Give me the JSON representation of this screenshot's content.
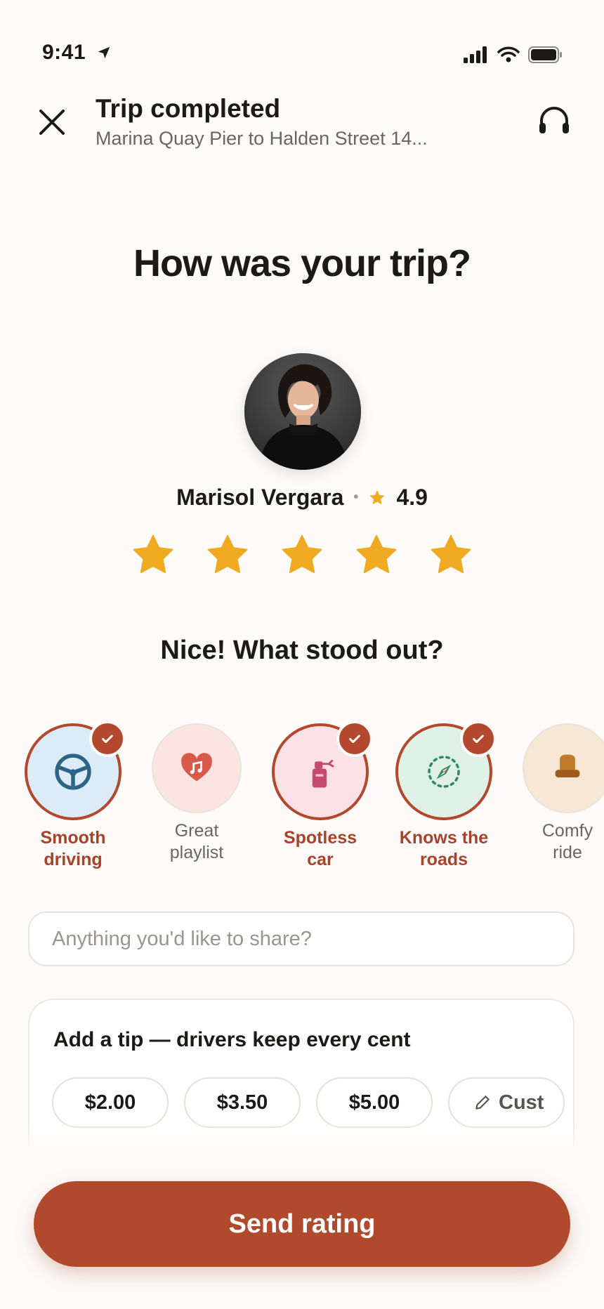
{
  "status_bar": {
    "time": "9:41"
  },
  "header": {
    "title": "Trip completed",
    "subtitle": "Marina Quay Pier to Halden Street 14..."
  },
  "question": "How was your trip?",
  "driver": {
    "name": "Marisol Vergara",
    "rating": "4.9"
  },
  "user_rating": {
    "stars_selected": 5,
    "stars_total": 5
  },
  "prompt": "Nice! What stood out?",
  "tags": [
    {
      "line1": "Smooth",
      "line2": "driving",
      "selected": true,
      "icon": "steering-wheel-icon"
    },
    {
      "line1": "Great",
      "line2": "playlist",
      "selected": false,
      "icon": "music-heart-icon"
    },
    {
      "line1": "Spotless",
      "line2": "car",
      "selected": true,
      "icon": "spray-bottle-icon"
    },
    {
      "line1": "Knows the",
      "line2": "roads",
      "selected": true,
      "icon": "compass-icon"
    },
    {
      "line1": "Comfy",
      "line2": "ride",
      "selected": false,
      "icon": "seat-icon"
    }
  ],
  "share": {
    "placeholder": "Anything you'd like to share?"
  },
  "tip": {
    "title": "Add a tip — drivers keep every cent",
    "options": [
      "$2.00",
      "$3.50",
      "$5.00"
    ],
    "custom_label": "Cust"
  },
  "send_label": "Send rating",
  "colors": {
    "accent": "#b14a2d",
    "star": "#f0aa22",
    "tag_bg_blue": "#dcecf7",
    "tag_bg_pink": "#fbe3df",
    "tag_bg_rose": "#fbe1e6",
    "tag_bg_mint": "#dff0e6",
    "tag_bg_sand": "#f6e6d4"
  }
}
